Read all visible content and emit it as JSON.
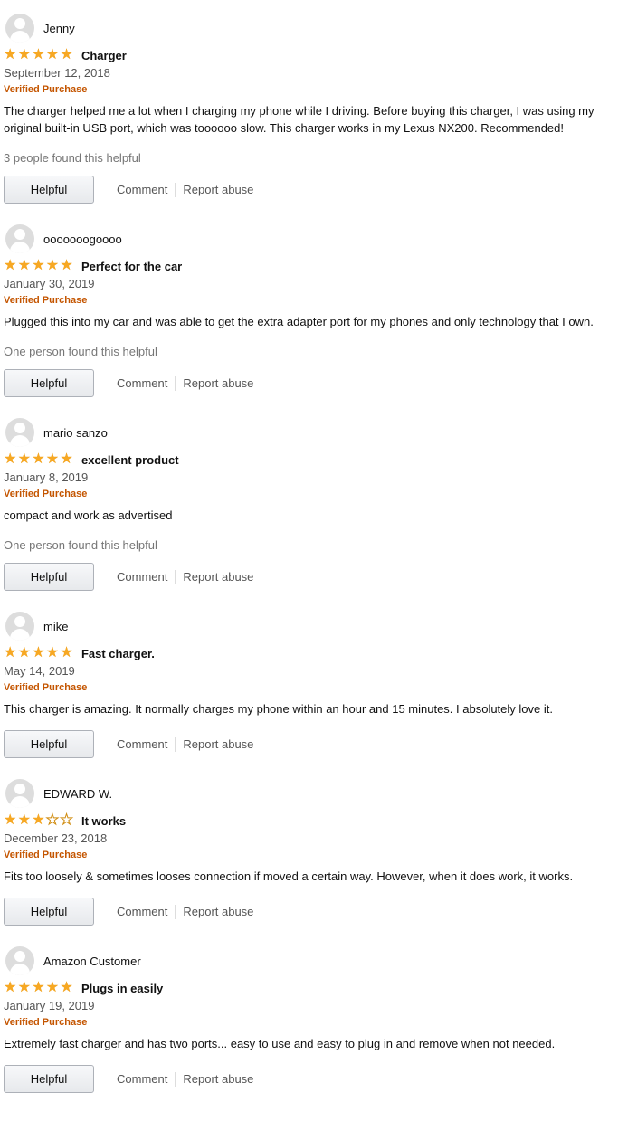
{
  "buttons": {
    "helpful": "Helpful",
    "comment": "Comment",
    "report": "Report abuse"
  },
  "reviews": [
    {
      "name": "Jenny",
      "rating": 5,
      "title": "Charger",
      "date": "September 12, 2018",
      "verified": "Verified Purchase",
      "text": "The charger helped me a lot when I charging my phone while I driving. Before buying this charger, I was using my original built-in USB port, which was toooooo slow. This charger works in my Lexus NX200. Recommended!",
      "helpful": "3 people found this helpful"
    },
    {
      "name": "ooooooogoooo",
      "rating": 5,
      "title": "Perfect for the car",
      "date": "January 30, 2019",
      "verified": "Verified Purchase",
      "text": "Plugged this into my car and was able to get the extra adapter port for my phones and only technology that I own.",
      "helpful": "One person found this helpful"
    },
    {
      "name": "mario sanzo",
      "rating": 5,
      "title": "excellent product",
      "date": "January 8, 2019",
      "verified": "Verified Purchase",
      "text": "compact and work as advertised",
      "helpful": "One person found this helpful"
    },
    {
      "name": "mike",
      "rating": 5,
      "title": "Fast charger.",
      "date": "May 14, 2019",
      "verified": "Verified Purchase",
      "text": "This charger is amazing. It normally charges my phone within an hour and 15 minutes. I absolutely love it.",
      "helpful": ""
    },
    {
      "name": "EDWARD W.",
      "rating": 3,
      "title": "It works",
      "date": "December 23, 2018",
      "verified": "Verified Purchase",
      "text": "Fits too loosely & sometimes looses connection if moved a certain way. However, when it does work, it works.",
      "helpful": ""
    },
    {
      "name": "Amazon Customer",
      "rating": 5,
      "title": "Plugs in easily",
      "date": "January 19, 2019",
      "verified": "Verified Purchase",
      "text": "Extremely fast charger and has two ports... easy to use and easy to plug in and remove when not needed.",
      "helpful": ""
    }
  ]
}
